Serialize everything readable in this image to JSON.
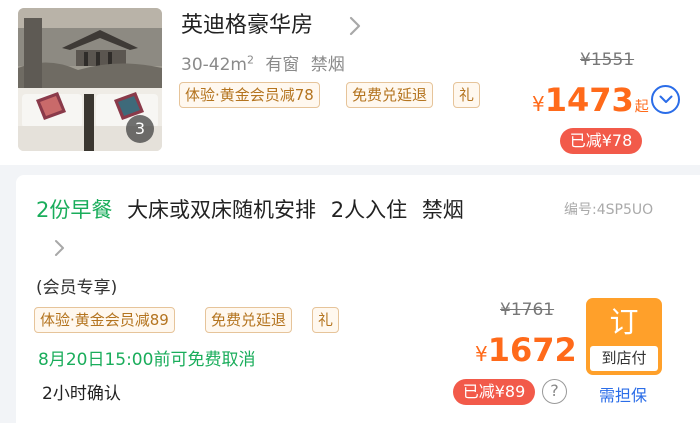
{
  "room": {
    "name": "英迪格豪华房",
    "photo_count": "3",
    "area": "30-42m",
    "area_unit": "2",
    "window": "有窗",
    "smoking": "禁烟",
    "tags": [
      "体验·黄金会员减78",
      "免费兑延退",
      "礼"
    ],
    "original_price": "¥1551",
    "price_symbol": "¥",
    "price": "1473",
    "price_suffix": "起",
    "discount": "已减¥78"
  },
  "plan": {
    "breakfast": "2份早餐",
    "bed": "大床或双床随机安排",
    "guests": "2人入住",
    "smoking": "禁烟",
    "code": "编号:4SP5UO",
    "member_only": "(会员专享)",
    "tags": [
      "体验·黄金会员减89",
      "免费兑延退",
      "礼"
    ],
    "cancel_policy": "8月20日15:00前可免费取消",
    "confirm_time": "2小时确认",
    "original_price": "¥1761",
    "price_symbol": "¥",
    "price": "1672",
    "discount": "已减¥89",
    "help_symbol": "?",
    "book_label": "订",
    "pay_label": "到店付",
    "guarantee": "需担保"
  },
  "colors": {
    "accent_orange": "#ff6a1a",
    "discount_red": "#f25a4a",
    "book_button": "#ffa02a",
    "link_blue": "#2b6de8",
    "breakfast_green": "#1aad5b",
    "tag_brown": "#b4741f"
  },
  "icons": {
    "room_chevron": "chevron-right-icon",
    "expand": "chevron-down-circle-icon",
    "plan_chevron": "chevron-right-icon",
    "help": "question-circle-icon"
  }
}
